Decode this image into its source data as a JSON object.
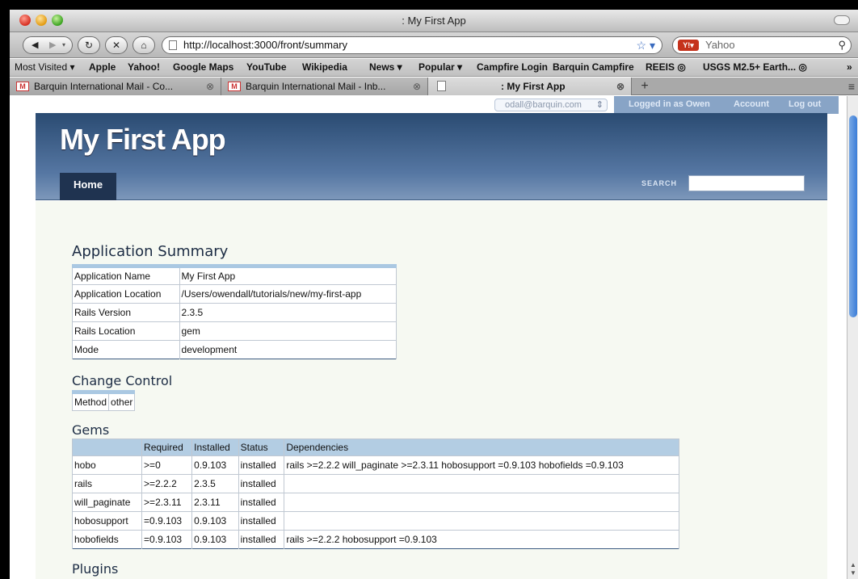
{
  "window": {
    "title": ": My First App"
  },
  "nav": {
    "url": "http://localhost:3000/front/summary",
    "search_placeholder": "Yahoo"
  },
  "bookmarks": [
    "Most Visited ▾",
    "Apple",
    "Yahoo!",
    "Google Maps",
    "YouTube",
    "Wikipedia",
    "News ▾",
    "Popular ▾",
    "Campfire Login",
    "Barquin Campfire",
    "REEIS ◎",
    "USGS M2.5+ Earth... ◎",
    "»"
  ],
  "tabs": [
    {
      "label": "Barquin International Mail - Co...",
      "favicon": "M"
    },
    {
      "label": "Barquin International Mail - Inb...",
      "favicon": "M"
    },
    {
      "label": ": My First App",
      "favicon": ""
    }
  ],
  "userbar": {
    "account_select": "odall@barquin.com",
    "logged_in": "Logged in as Owen",
    "account": "Account",
    "logout": "Log out"
  },
  "app": {
    "title": "My First App",
    "home_tab": "Home",
    "search_label": "SEARCH"
  },
  "summary": {
    "heading": "Application Summary",
    "rows": [
      [
        "Application Name",
        "My First App"
      ],
      [
        "Application Location",
        "/Users/owendall/tutorials/new/my-first-app"
      ],
      [
        "Rails Version",
        "2.3.5"
      ],
      [
        "Rails Location",
        "gem"
      ],
      [
        "Mode",
        "development"
      ]
    ]
  },
  "change_control": {
    "heading": "Change Control",
    "row": [
      "Method",
      "other"
    ]
  },
  "gems": {
    "heading": "Gems",
    "columns": [
      "",
      "Required",
      "Installed",
      "Status",
      "Dependencies"
    ],
    "rows": [
      [
        "hobo",
        ">=0",
        "0.9.103",
        "installed",
        "rails >=2.2.2 will_paginate >=2.3.11 hobosupport =0.9.103 hobofields =0.9.103"
      ],
      [
        "rails",
        ">=2.2.2",
        "2.3.5",
        "installed",
        ""
      ],
      [
        "will_paginate",
        ">=2.3.11",
        "2.3.11",
        "installed",
        ""
      ],
      [
        "hobosupport",
        "=0.9.103",
        "0.9.103",
        "installed",
        ""
      ],
      [
        "hobofields",
        "=0.9.103",
        "0.9.103",
        "installed",
        "rails >=2.2.2 hobosupport =0.9.103"
      ]
    ]
  },
  "plugins": {
    "heading": "Plugins"
  }
}
